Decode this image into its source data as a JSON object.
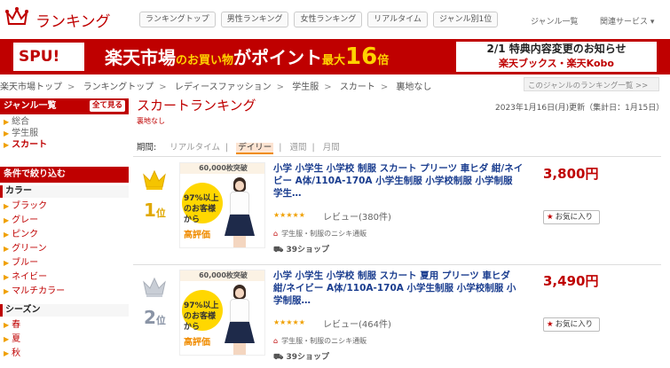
{
  "header": {
    "logo_text": "ランキング",
    "nav": [
      "ランキングトップ",
      "男性ランキング",
      "女性ランキング",
      "リアルタイム",
      "ジャンル別1位"
    ],
    "genre_list": "ジャンル一覧",
    "related": "関連サービス ▾"
  },
  "banner": {
    "spu": "SPU!",
    "main_a": "楽天市場",
    "main_b": "のお買い物",
    "main_c": "がポイント",
    "main_d": "最大",
    "main_e": "16",
    "main_f": "倍",
    "right_l1": "2/1 特典内容変更のお知らせ",
    "right_l2": "楽天ブックス・楽天Kobo"
  },
  "breadcrumb": [
    "楽天市場トップ",
    "ランキングトップ",
    "レディースファッション",
    "学生服",
    "スカート",
    "裏地なし"
  ],
  "genre_ranking_link": "このジャンルのランキング一覧 >>",
  "sidebar": {
    "genre_title": "ジャンル一覧",
    "all_button": "全て見る",
    "genres": [
      "総合",
      "学生服",
      "スカート"
    ],
    "filter_title": "条件で絞り込む",
    "color_title": "カラー",
    "colors": [
      "ブラック",
      "グレー",
      "ピンク",
      "グリーン",
      "ブルー",
      "ネイビー",
      "マルチカラー"
    ],
    "season_title": "シーズン",
    "seasons": [
      "春",
      "夏",
      "秋"
    ]
  },
  "main": {
    "title": "スカートランキング",
    "subtitle": "裏地なし",
    "updated": "2023年1月16日(月)更新（集計日：1月15日）",
    "period_label": "期間:",
    "periods": [
      "リアルタイム",
      "デイリー",
      "週間",
      "月間"
    ],
    "active_period": "デイリー"
  },
  "items": [
    {
      "rank": "1",
      "rank_suffix": "位",
      "title": "小学 小学生 小学校 制服 スカート プリーツ 車ヒダ 紺/ネイビー A体/110A-170A 小学生制服 小学校制服 小学制服 学生…",
      "price": "3,800円",
      "fav": "お気に入り",
      "stars": "★★★★★",
      "reviews": "レビュー(380件)",
      "shop": "学生服・制服のニシキ通販",
      "shop_count": "39ショップ",
      "thumb_top": "60,000枚突破",
      "thumb_97": "97%以上のお客様から",
      "thumb_hyo": "高評価"
    },
    {
      "rank": "2",
      "rank_suffix": "位",
      "title": "小学 小学生 小学校 制服 スカート 夏用 プリーツ 車ヒダ 紺/ネイビー A体/110A-170A 小学生制服 小学校制服 小学制服…",
      "price": "3,490円",
      "fav": "お気に入り",
      "stars": "★★★★★",
      "reviews": "レビュー(464件)",
      "shop": "学生服・制服のニシキ通販",
      "shop_count": "39ショップ",
      "thumb_top": "60,000枚突破",
      "thumb_97": "97%以上のお客様から",
      "thumb_hyo": "高評価"
    }
  ]
}
